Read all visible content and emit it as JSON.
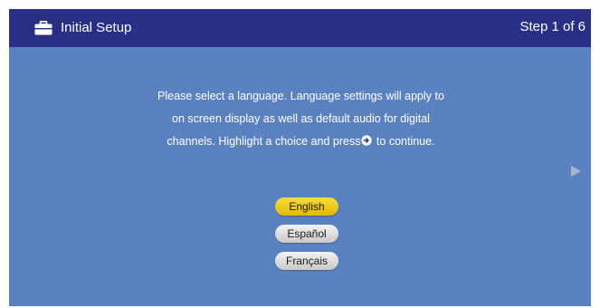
{
  "header": {
    "icon": "briefcase-icon",
    "title": "Initial Setup",
    "step": "Step 1 of 6"
  },
  "instructions": {
    "line1": "Please select a language.  Language settings will apply to",
    "line2": "on screen display as well as default audio for digital",
    "line3_before": "channels. Highlight a choice and press",
    "line3_icon": "ok-button-icon",
    "line3_after": " to continue."
  },
  "navigation": {
    "next_icon": "next-arrow-icon"
  },
  "languages": {
    "selected": "English",
    "options": [
      "English",
      "Español",
      "Français"
    ]
  },
  "colors": {
    "background": "#5b82c0",
    "header": "#2a2f86",
    "selected_button": "#f0c928",
    "button": "#dcdcdc",
    "text": "#ffffff"
  }
}
